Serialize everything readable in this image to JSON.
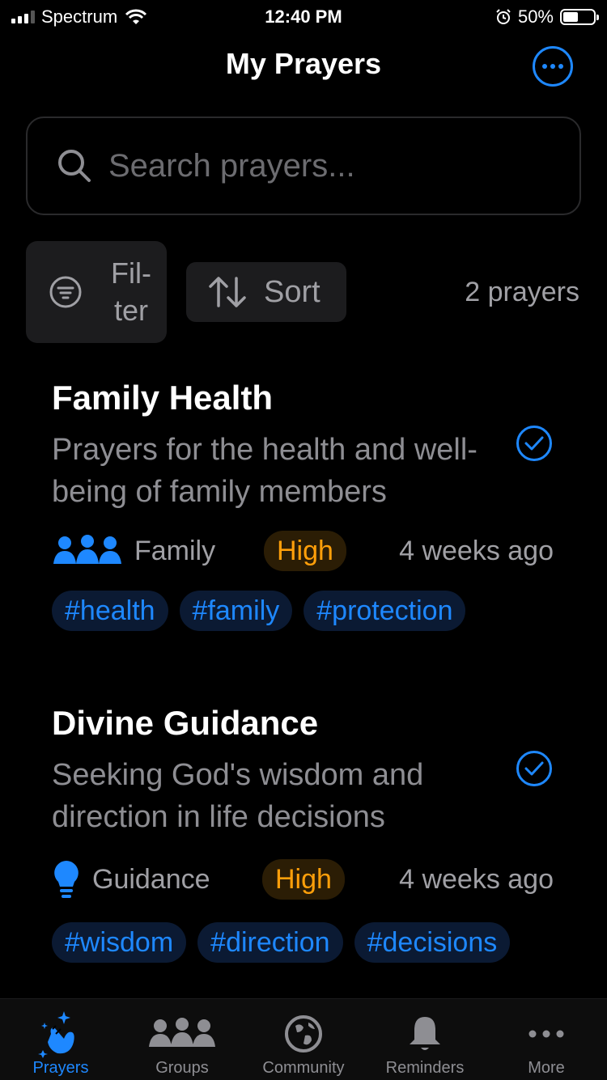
{
  "status_bar": {
    "carrier": "Spectrum",
    "time": "12:40 PM",
    "battery": "50%",
    "battery_level": 0.5
  },
  "header": {
    "title": "My Prayers"
  },
  "search": {
    "placeholder": "Search prayers..."
  },
  "toolbar": {
    "filter_label": "Fil- ter",
    "sort_label": "Sort",
    "count_text": "2 prayers"
  },
  "prayers": [
    {
      "title": "Family Health",
      "description": "Prayers for the health and well-being of family members",
      "category": "Family",
      "category_icon": "people-icon",
      "priority": "High",
      "time": "4 weeks ago",
      "tags": [
        "#health",
        "#family",
        "#protection"
      ],
      "answered": true
    },
    {
      "title": "Divine Guidance",
      "description": "Seeking God's wisdom and direction in life decisions",
      "category": "Guidance",
      "category_icon": "lightbulb-icon",
      "priority": "High",
      "time": "4 weeks ago",
      "tags": [
        "#wisdom",
        "#direction",
        "#decisions"
      ],
      "answered": true
    }
  ],
  "tabbar": {
    "items": [
      {
        "label": "Prayers",
        "icon": "praying-hands-icon",
        "active": true
      },
      {
        "label": "Groups",
        "icon": "people-icon",
        "active": false
      },
      {
        "label": "Community",
        "icon": "globe-icon",
        "active": false
      },
      {
        "label": "Reminders",
        "icon": "bell-icon",
        "active": false
      },
      {
        "label": "More",
        "icon": "more-dots-icon",
        "active": false
      }
    ]
  },
  "colors": {
    "accent": "#1e88ff",
    "priority_high": "#ff9f0a",
    "background": "#000000"
  }
}
